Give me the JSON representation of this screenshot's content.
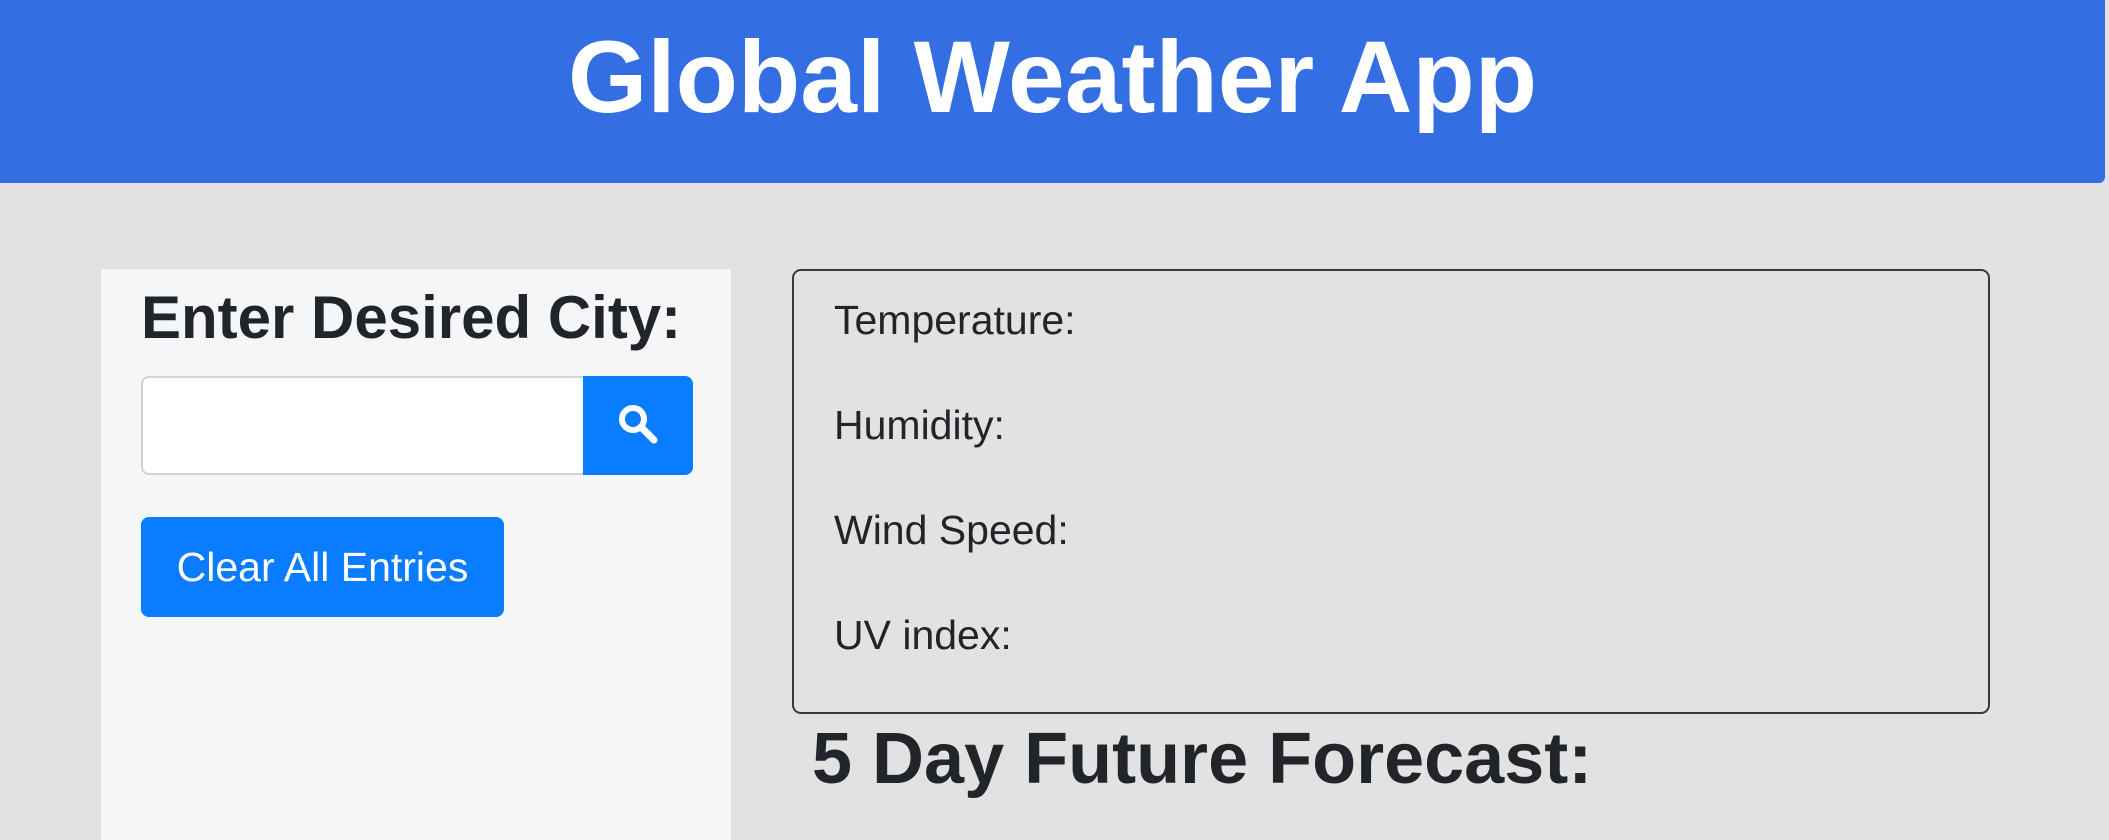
{
  "header": {
    "title": "Global Weather App"
  },
  "sidebar": {
    "city_label": "Enter Desired City:",
    "search_input": {
      "value": "",
      "placeholder": ""
    },
    "search_icon": "search-icon",
    "clear_label": "Clear All Entries"
  },
  "weather": {
    "temperature_label": "Temperature:",
    "humidity_label": "Humidity:",
    "wind_label": "Wind Speed:",
    "uv_label": "UV index:"
  },
  "forecast": {
    "title": "5 Day Future Forecast:"
  },
  "colors": {
    "header_bg": "#336ee2",
    "button_bg": "#0a7cff",
    "page_bg": "#e2e2e2",
    "sidebar_bg": "#f5f6f8"
  }
}
